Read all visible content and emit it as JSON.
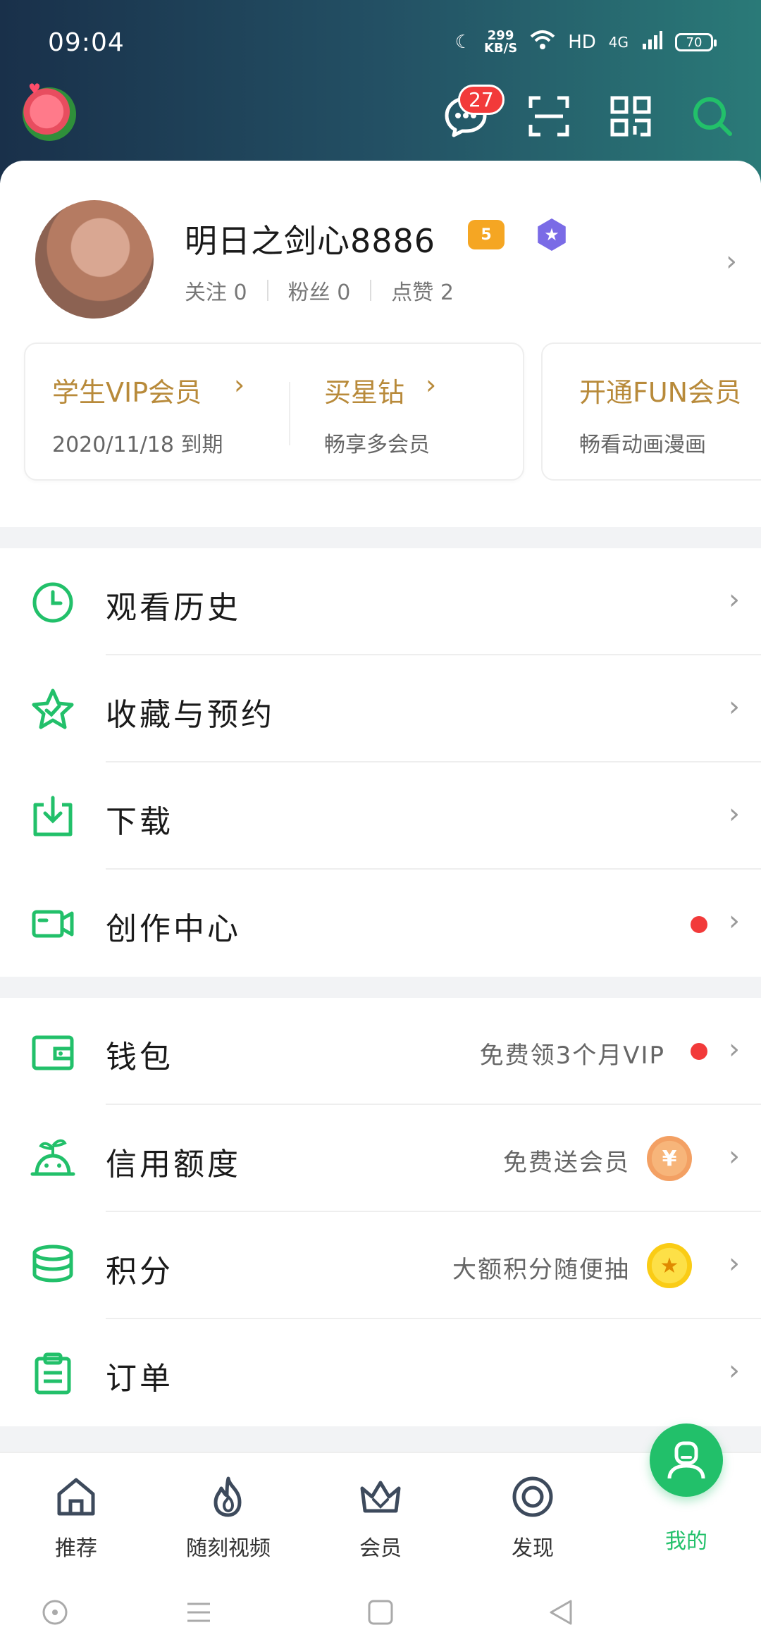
{
  "status_bar": {
    "time": "09:04",
    "net_speed_top": "299",
    "net_speed_bottom": "KB/S",
    "hd": "HD",
    "network": "4G",
    "battery": "70"
  },
  "header": {
    "message_badge": "27",
    "icons": [
      "message-icon",
      "scan-icon",
      "qrcode-icon",
      "search-icon"
    ]
  },
  "profile": {
    "name": "明日之剑心8886",
    "level": "5",
    "stats": [
      {
        "label": "关注",
        "value": "0"
      },
      {
        "label": "粉丝",
        "value": "0"
      },
      {
        "label": "点赞",
        "value": "2"
      }
    ]
  },
  "vip": {
    "student_vip_title": "学生VIP会员",
    "student_vip_expire": "2020/11/18 到期",
    "buy_star_title": "买星钻",
    "buy_star_sub": "畅享多会员",
    "fun_title": "开通FUN会员",
    "fun_sub": "畅看动画漫画"
  },
  "menu_primary": [
    {
      "label": "观看历史",
      "icon": "clock-icon"
    },
    {
      "label": "收藏与预约",
      "icon": "star-icon"
    },
    {
      "label": "下载",
      "icon": "download-icon"
    },
    {
      "label": "创作中心",
      "icon": "video-camera-icon"
    }
  ],
  "menu_secondary": [
    {
      "label": "钱包",
      "right": "免费领3个月VIP",
      "icon": "wallet-icon"
    },
    {
      "label": "信用额度",
      "right": "免费送会员",
      "icon": "sprout-icon"
    },
    {
      "label": "积分",
      "right": "大额积分随便抽",
      "icon": "coins-stack-icon"
    },
    {
      "label": "订单",
      "right": "",
      "icon": "clipboard-icon"
    }
  ],
  "bottom_nav": [
    {
      "label": "推荐"
    },
    {
      "label": "随刻视频"
    },
    {
      "label": "会员"
    },
    {
      "label": "发现"
    },
    {
      "label": "我的"
    }
  ],
  "colors": {
    "accent_green": "#22c06a",
    "vip_gold": "#b88a3a",
    "badge_red": "#f23a3a"
  }
}
